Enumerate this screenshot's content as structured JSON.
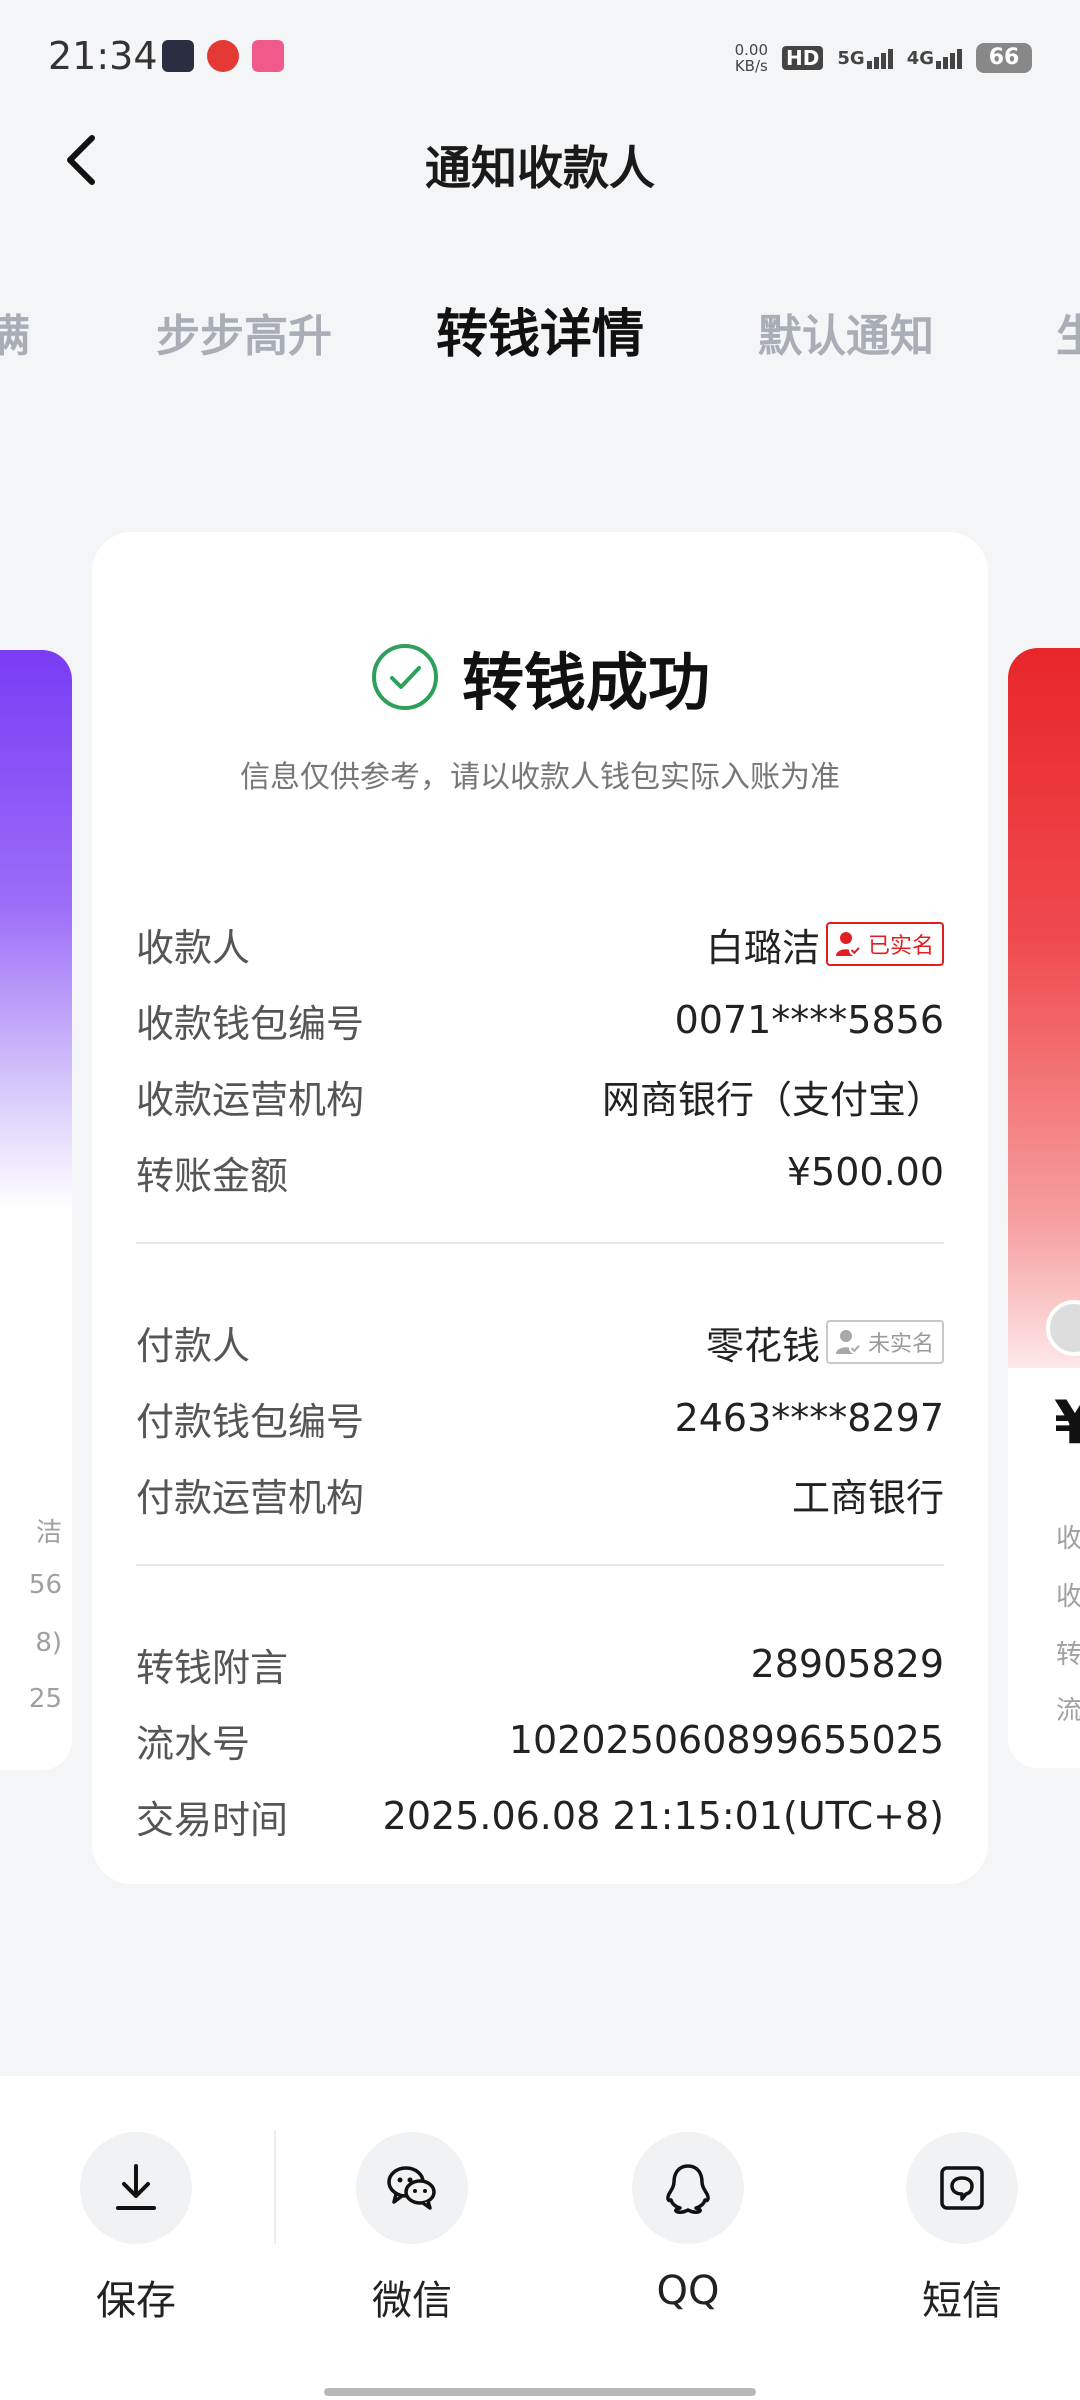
{
  "status_bar": {
    "time": "21:34",
    "net_speed_value": "0.00",
    "net_speed_unit": "KB/s",
    "hd_label": "HD",
    "sim1_label": "5G",
    "sim2_label": "4G",
    "battery": "66"
  },
  "header": {
    "title": "通知收款人"
  },
  "tabs": [
    {
      "label": "满"
    },
    {
      "label": "步步高升"
    },
    {
      "label": "转钱详情"
    },
    {
      "label": "默认通知"
    },
    {
      "label": "生"
    }
  ],
  "card": {
    "status_title": "转钱成功",
    "disclaimer": "信息仅供参考，请以收款人钱包实际入账为准",
    "payee": {
      "rows": [
        {
          "label": "收款人",
          "value": "白璐洁",
          "badge": "已实名"
        },
        {
          "label": "收款钱包编号",
          "value": "0071****5856"
        },
        {
          "label": "收款运营机构",
          "value": "网商银行（支付宝）"
        },
        {
          "label": "转账金额",
          "value": "¥500.00"
        }
      ]
    },
    "payer": {
      "rows": [
        {
          "label": "付款人",
          "value": "零花钱",
          "badge": "未实名"
        },
        {
          "label": "付款钱包编号",
          "value": "2463****8297"
        },
        {
          "label": "付款运营机构",
          "value": "工商银行"
        }
      ]
    },
    "extra": {
      "rows": [
        {
          "label": "转钱附言",
          "value": "28905829"
        },
        {
          "label": "流水号",
          "value": "102025060899655025"
        },
        {
          "label": "交易时间",
          "value": "2025.06.08 21:15:01(UTC+8)"
        }
      ]
    }
  },
  "peek_left_lines": [
    "洁",
    "56",
    "8)",
    "25"
  ],
  "peek_right": {
    "yen": "¥",
    "lines": [
      "收",
      "收",
      "转",
      "流"
    ]
  },
  "share_bar": [
    {
      "label": "保存",
      "icon": "download-icon"
    },
    {
      "label": "微信",
      "icon": "wechat-icon"
    },
    {
      "label": "QQ",
      "icon": "qq-icon"
    },
    {
      "label": "短信",
      "icon": "sms-icon"
    }
  ],
  "colors": {
    "accent_red": "#e02020",
    "success_green": "#2ea05a",
    "background": "#f4f5f7"
  }
}
